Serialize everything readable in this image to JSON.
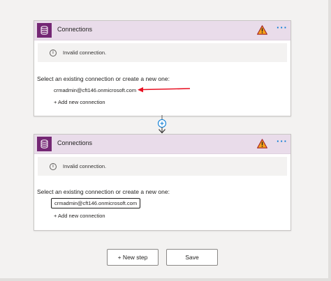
{
  "cards": [
    {
      "title": "Connections",
      "info_text": "Invalid connection.",
      "select_label": "Select an existing connection or create a new one:",
      "connection": "crmadmin@cft146.onmicrosoft.com",
      "add_connection": "+ Add new connection"
    },
    {
      "title": "Connections",
      "info_text": "Invalid connection.",
      "select_label": "Select an existing connection or create a new one:",
      "connection": "crmadmin@cft146.onmicrosoft.com",
      "add_connection": "+ Add new connection"
    }
  ],
  "icons": {
    "header": "database-icon",
    "warning": "warning-icon",
    "more": "more-options-icon",
    "info": "info-icon",
    "connector": "add-step-icon"
  },
  "more_glyph": "···",
  "info_glyph": "i",
  "footer": {
    "new_step": "+ New step",
    "save": "Save"
  },
  "colors": {
    "header_bg": "#e9dcea",
    "icon_bg": "#742774",
    "accent": "#0078d4",
    "warning": "#d83b01",
    "annotation_arrow": "#e81123"
  }
}
